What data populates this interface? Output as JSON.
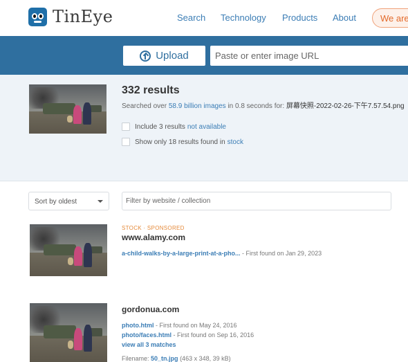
{
  "header": {
    "logo_text": "TinEye",
    "nav": [
      "Search",
      "Technology",
      "Products",
      "About"
    ],
    "cta": "We are"
  },
  "upload": {
    "button_label": "Upload",
    "url_placeholder": "Paste or enter image URL"
  },
  "summary": {
    "results": "332 results",
    "searched_prefix": "Searched over",
    "searched_count": "58.9 billion images",
    "searched_middle": "in 0.8 seconds for:",
    "filename": "屏幕快照-2022-02-26-下午7.57.54.png",
    "option1_text": "Include 3 results",
    "option1_link": "not available",
    "option2_text": "Show only 18 results found in",
    "option2_link": "stock"
  },
  "filters": {
    "sort_label": "Sort by oldest",
    "filter_placeholder": "Filter by website / collection"
  },
  "results": [
    {
      "tag": "STOCK · SPONSORED",
      "domain": "www.alamy.com",
      "matches": [
        {
          "link": "a-child-walks-by-a-large-print-at-a-pho...",
          "found": " - First found on Jan 29, 2023"
        }
      ]
    },
    {
      "domain": "gordonua.com",
      "matches": [
        {
          "link": "photo.html",
          "found": " - First found on May 24, 2016"
        },
        {
          "link": "photo/faces.html",
          "found": " - First found on Sep 16, 2016"
        }
      ],
      "view_all": "view all 3 matches",
      "filename_label": "Filename:",
      "filename": "50_tn.jpg",
      "filename_meta": "(463 x 348, 39 kB)"
    }
  ]
}
